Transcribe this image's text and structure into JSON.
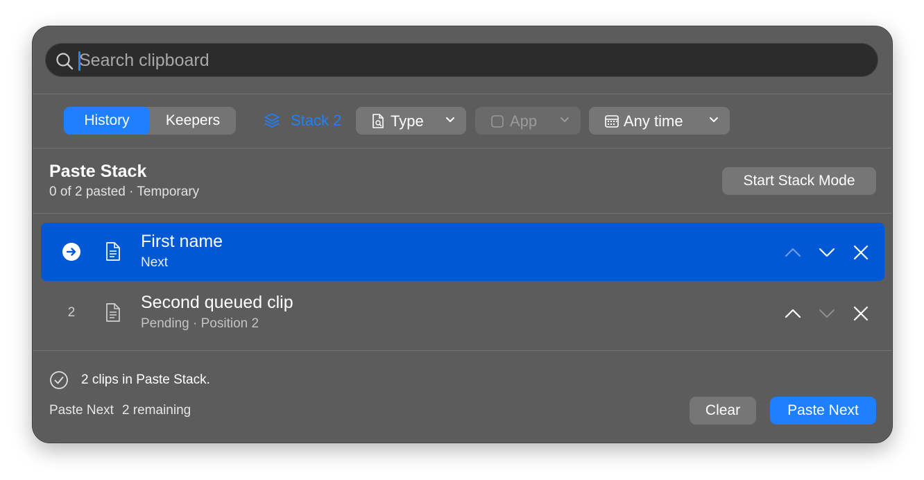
{
  "search": {
    "placeholder": "Search clipboard",
    "value": ""
  },
  "filter_bar": {
    "tabs": [
      {
        "label": "History",
        "active": true
      },
      {
        "label": "Keepers",
        "active": false
      }
    ],
    "stack_label": "Stack 2",
    "type_label": "Type",
    "app_label": "App",
    "time_label": "Any time"
  },
  "stack_header": {
    "title": "Paste Stack",
    "subtitle": "0 of 2 pasted · Temporary",
    "start_button": "Start Stack Mode"
  },
  "rows": [
    {
      "index": "",
      "title": "First name",
      "subtitle": "Next",
      "selected": true
    },
    {
      "index": "2",
      "title": "Second queued clip",
      "subtitle": "Pending · Position 2",
      "selected": false
    }
  ],
  "footer": {
    "status": "2 clips in Paste Stack.",
    "hint_action": "Paste Next",
    "hint_remaining": "2 remaining",
    "clear_button": "Clear",
    "paste_next_button": "Paste Next"
  },
  "colors": {
    "accent": "#1f80ff",
    "selected_row": "#0058d4",
    "panel": "#5c5c5c"
  }
}
